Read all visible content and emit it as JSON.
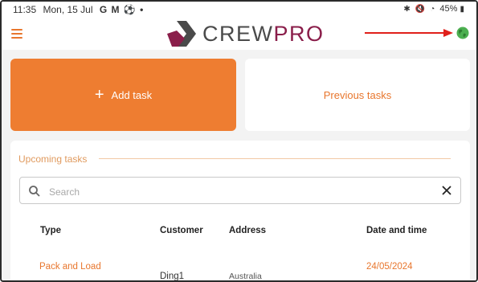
{
  "status_bar": {
    "time": "11:35",
    "date": "Mon, 15 Jul",
    "notification_icons": "G M ⚽ •",
    "battery": "45%"
  },
  "app": {
    "logo_brand": "CREW",
    "logo_suffix": "PRO",
    "menu_icon": "hamburger-menu-icon",
    "language_icon": "globe-icon",
    "colors": {
      "accent": "#ee7d31",
      "brand_dark": "#4a4a4a",
      "brand_maroon": "#8a1e4a",
      "annotation_arrow": "#e0201b"
    }
  },
  "actions": {
    "add_task": "Add task",
    "previous_tasks": "Previous tasks"
  },
  "upcoming": {
    "title": "Upcoming tasks",
    "search_placeholder": "Search",
    "columns": {
      "type": "Type",
      "customer": "Customer",
      "address": "Address",
      "datetime": "Date and time"
    },
    "rows": [
      {
        "type": "Pack and Load",
        "customer": "Ding1",
        "address": "Australia",
        "datetime": "24/05/2024"
      }
    ]
  }
}
